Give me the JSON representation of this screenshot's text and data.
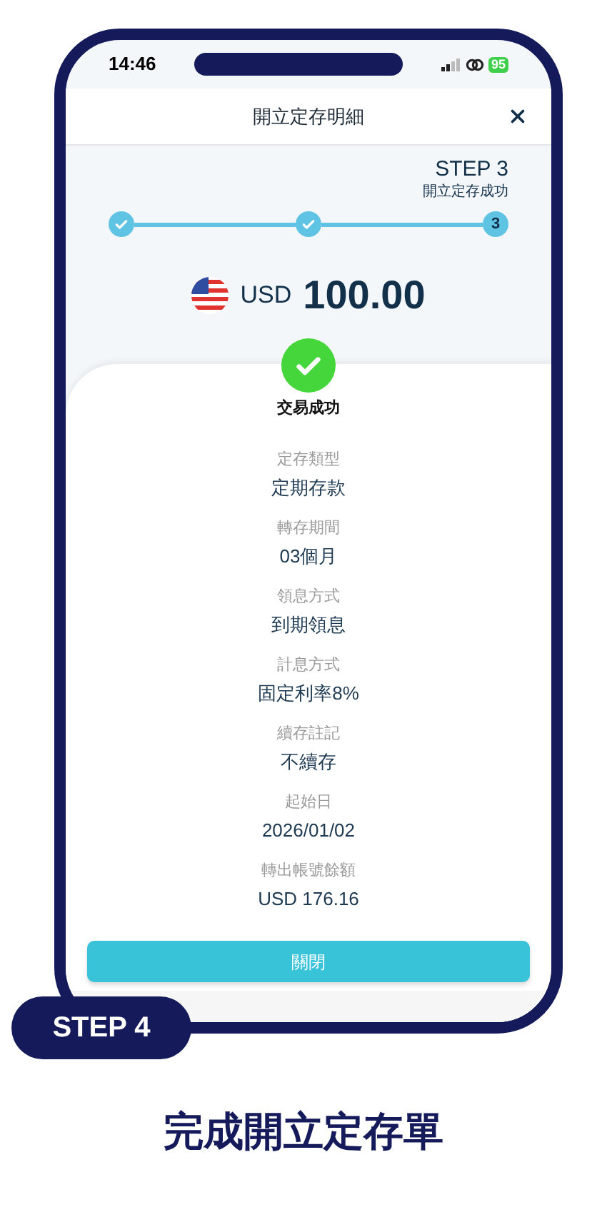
{
  "status_bar": {
    "time": "14:46",
    "battery": "95"
  },
  "header": {
    "title": "開立定存明細"
  },
  "progress": {
    "step_label": "STEP 3",
    "step_caption": "開立定存成功",
    "steps": [
      {
        "kind": "done"
      },
      {
        "kind": "done"
      },
      {
        "kind": "current",
        "label": "3"
      }
    ]
  },
  "amount": {
    "currency": "USD",
    "value": "100.00"
  },
  "result": {
    "status": "交易成功"
  },
  "details": [
    {
      "label": "定存類型",
      "value": "定期存款"
    },
    {
      "label": "轉存期間",
      "value": "03個月"
    },
    {
      "label": "領息方式",
      "value": "到期領息"
    },
    {
      "label": "計息方式",
      "value": "固定利率8%"
    },
    {
      "label": "續存註記",
      "value": "不續存"
    },
    {
      "label": "起始日",
      "value": "2026/01/02"
    },
    {
      "label": "轉出帳號餘額",
      "value": "USD 176.16"
    }
  ],
  "close_button": "關閉",
  "badge": "STEP 4",
  "caption": "完成開立定存單"
}
